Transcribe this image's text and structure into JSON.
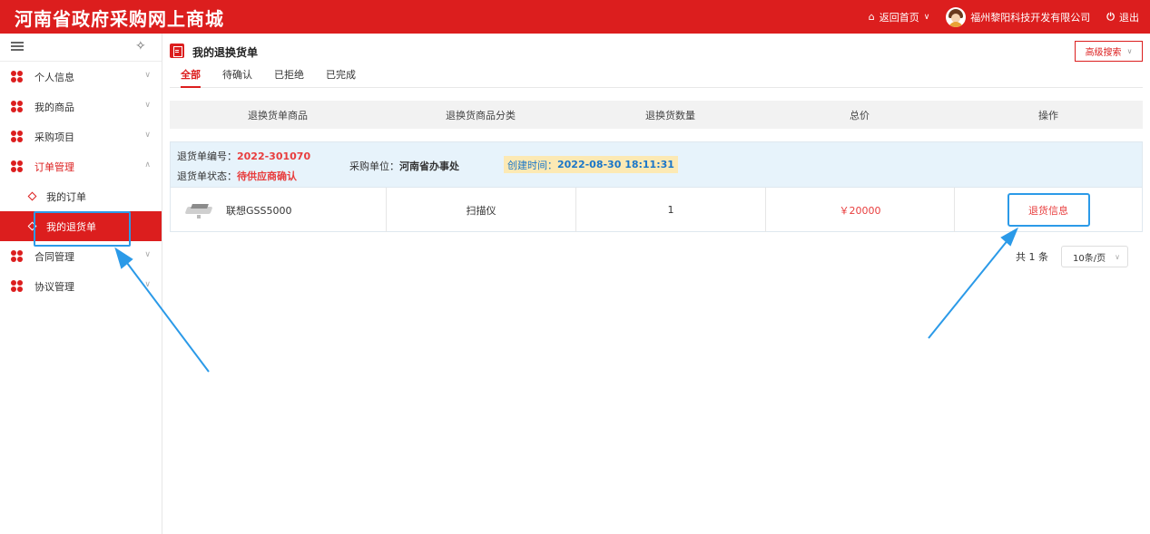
{
  "header": {
    "site_title": "河南省政府采购网上商城",
    "home_label": "返回首页",
    "company_name": "福州黎阳科技开发有限公司",
    "logout_label": "退出"
  },
  "sidebar": {
    "items": [
      {
        "label": "个人信息"
      },
      {
        "label": "我的商品"
      },
      {
        "label": "采购项目"
      },
      {
        "label": "订单管理"
      },
      {
        "label": "合同管理"
      },
      {
        "label": "协议管理"
      }
    ],
    "sub_items": [
      {
        "label": "我的订单"
      },
      {
        "label": "我的退货单"
      }
    ]
  },
  "page": {
    "title": "我的退换货单",
    "advanced_search": "高级搜索",
    "tabs": [
      "全部",
      "待确认",
      "已拒绝",
      "已完成"
    ]
  },
  "table": {
    "headers": [
      "退换货单商品",
      "退换货商品分类",
      "退换货数量",
      "总价",
      "操作"
    ]
  },
  "order": {
    "number_label": "退货单编号：",
    "number": "2022-301070",
    "status_label": "退货单状态：",
    "status": "待供应商确认",
    "buyer_label": "采购单位：",
    "buyer": "河南省办事处",
    "created_label": "创建时间：",
    "created": "2022-08-30 18:11:31",
    "product_name": "联想GSS5000",
    "category": "扫描仪",
    "quantity": "1",
    "price": "￥20000",
    "action_label": "退货信息"
  },
  "pagination": {
    "total": "共 1 条",
    "page_size": "10条/页"
  },
  "colors": {
    "brand_red": "#dc1e1e",
    "annotation_blue": "#2b9ae8"
  }
}
